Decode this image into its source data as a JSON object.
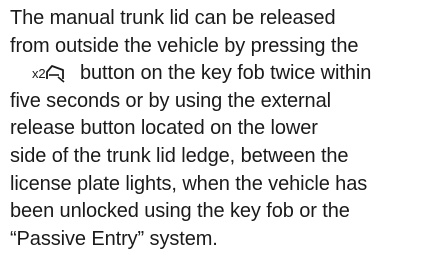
{
  "document": {
    "line_1": "The manual trunk lid can be released",
    "line_2": "from outside the vehicle by pressing the",
    "line_3_after_icon": "button on the key fob twice within",
    "line_4": "five seconds or by using the external",
    "line_5": "release button located on the lower",
    "line_6": "side of the trunk lid ledge, between the",
    "line_7": "license plate lights, when the vehicle has",
    "line_8": "been unlocked using the key fob or the",
    "line_9": "“Passive Entry” system.",
    "icon": {
      "name": "trunk-release-x2-icon",
      "label": "x2"
    }
  }
}
